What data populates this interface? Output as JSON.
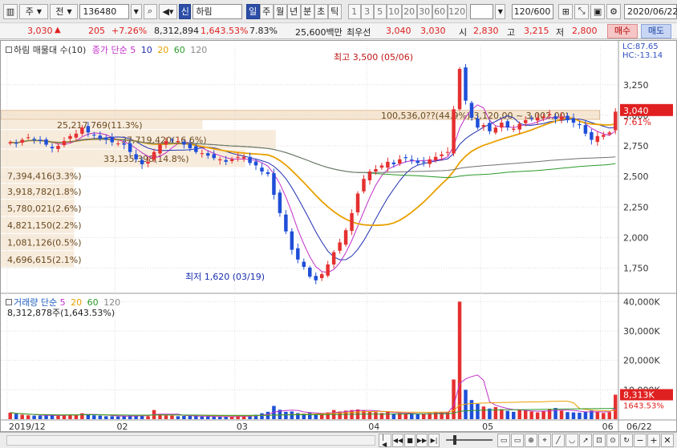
{
  "toolbar": {
    "market": "주",
    "mode": "전",
    "code": "136480",
    "badge": "신",
    "name": "하림",
    "periods": [
      "일",
      "주",
      "월",
      "년",
      "분",
      "초",
      "틱"
    ],
    "active_period": "일",
    "intervals": [
      "1",
      "3",
      "5",
      "10",
      "20",
      "30",
      "60",
      "120"
    ],
    "count": "120/600",
    "date": "2020/06/22"
  },
  "quote": {
    "price": "3,030",
    "change": "205",
    "pct": "+7.26%",
    "volume": "8,312,894",
    "vol_ratio": "1,643.53%",
    "turnover": "7.83%",
    "amount": "25,600백만",
    "pref_label": "최우선",
    "ask": "3,040",
    "bid": "3,030",
    "open_label": "시",
    "open": "2,830",
    "high_label": "고",
    "high": "3,215",
    "low_label": "저",
    "low": "2,800",
    "buy_label": "매수",
    "sell_label": "매도"
  },
  "chart_data": {
    "type": "candlestick",
    "title": "하림",
    "legend_price": {
      "label": "하림 매물대 수(10)",
      "ma_label": "종가 단순",
      "periods": [
        "5",
        "10",
        "20",
        "60",
        "120"
      ]
    },
    "legend_volume": {
      "label": "거래량 단순",
      "periods": [
        "5",
        "20",
        "60",
        "120"
      ]
    },
    "lc_hc": {
      "lc": "LC:87.65",
      "hc": "HC:-13.14"
    },
    "y_ticks": [
      "3,250",
      "3,000",
      "2,750",
      "2,500",
      "2,250",
      "2,000",
      "1,750"
    ],
    "y_tick_values": [
      3250,
      3000,
      2750,
      2500,
      2250,
      2000,
      1750
    ],
    "ylim": [
      1550,
      3570
    ],
    "vol_ticks": [
      "40,000K",
      "30,000K",
      "20,000K",
      "10,000K"
    ],
    "vol_tick_values": [
      40000,
      30000,
      20000,
      10000
    ],
    "vol_ylim": [
      0,
      42000
    ],
    "x_ticks": [
      "2019/12",
      "02",
      "03",
      "04",
      "05",
      "06",
      "06/22"
    ],
    "current_price_tag": "3,040",
    "current_pct_tag": "7.61%",
    "current_price": 3040,
    "current_vol_tag": "8,313K",
    "current_vol_pct_tag": "1643.53%",
    "current_vol": 8313,
    "high_annotation": "최고 3,500 (05/06)",
    "low_annotation": "최저 1,620 (03/19)",
    "volume_profile": [
      {
        "price_top": 3040,
        "price_bottom": 2960,
        "label": "100,536,0??(44.9%)(3,120,00 ~ 3,002,00)",
        "width": 0.98
      },
      {
        "price_top": 2960,
        "price_bottom": 2880,
        "label": "25,217,769(11.3%)",
        "width": 0.33
      },
      {
        "price_top": 2880,
        "price_bottom": 2720,
        "label": "37,719,420(16.6%)",
        "width": 0.45
      },
      {
        "price_top": 2720,
        "price_bottom": 2570,
        "label": "33,135,398(14.8%)",
        "width": 0.4
      },
      {
        "price_top": 2570,
        "price_bottom": 2440,
        "label": "7,394,416(3.3%)",
        "width": 0.12
      },
      {
        "price_top": 2440,
        "price_bottom": 2310,
        "label": "3,918,782(1.8%)",
        "width": 0.12
      },
      {
        "price_top": 2310,
        "price_bottom": 2170,
        "label": "5,780,021(2.6%)",
        "width": 0.12
      },
      {
        "price_top": 2170,
        "price_bottom": 2030,
        "label": "4,821,150(2.2%)",
        "width": 0.12
      },
      {
        "price_top": 2030,
        "price_bottom": 1890,
        "label": "1,081,126(0.5%)",
        "width": 0.12
      },
      {
        "price_top": 1890,
        "price_bottom": 1750,
        "label": "4,696,615(2.1%)",
        "width": 0.12
      }
    ],
    "volume_info": "8,312,878주(1,643.53%)",
    "colors": {
      "up": "#e53030",
      "down": "#1f4fd8",
      "ma5": "#c030c8",
      "ma10": "#1f2fb0",
      "ma20": "#e8a000",
      "ma60": "#2a9a2a",
      "ma120": "#707070"
    },
    "closes": [
      2780,
      2770,
      2800,
      2820,
      2800,
      2790,
      2760,
      2730,
      2750,
      2790,
      2830,
      2850,
      2900,
      2860,
      2840,
      2810,
      2800,
      2780,
      2770,
      2760,
      2700,
      2640,
      2600,
      2620,
      2700,
      2760,
      2790,
      2800,
      2790,
      2760,
      2730,
      2700,
      2690,
      2670,
      2650,
      2640,
      2620,
      2640,
      2660,
      2660,
      2610,
      2590,
      2540,
      2520,
      2350,
      2200,
      2050,
      1900,
      1820,
      1760,
      1680,
      1650,
      1700,
      1780,
      1880,
      1960,
      2060,
      2200,
      2360,
      2480,
      2540,
      2560,
      2590,
      2620,
      2600,
      2640,
      2650,
      2630,
      2610,
      2620,
      2640,
      2660,
      2680,
      2700,
      3050,
      3380,
      3120,
      2980,
      2900,
      2920,
      2870,
      2900,
      2940,
      2900,
      2890,
      2930,
      2960,
      2970,
      2980,
      2990,
      3010,
      2970,
      2990,
      2960,
      2940,
      2920,
      2850,
      2800,
      2830,
      2840,
      2860,
      3030
    ],
    "volumes": [
      2200,
      1800,
      1500,
      1300,
      1200,
      1200,
      1400,
      1300,
      1100,
      1500,
      1600,
      1400,
      2000,
      1700,
      1300,
      1200,
      1000,
      1000,
      900,
      1000,
      1200,
      1300,
      1400,
      1000,
      3100,
      1800,
      1300,
      1200,
      1000,
      1100,
      1100,
      1000,
      900,
      900,
      800,
      800,
      800,
      900,
      1100,
      1000,
      1200,
      1500,
      2000,
      2500,
      4500,
      3200,
      2500,
      2600,
      2100,
      1900,
      2200,
      1700,
      1900,
      2300,
      3100,
      2600,
      2900,
      3100,
      3300,
      2900,
      2600,
      2400,
      2100,
      2500,
      1900,
      2000,
      1900,
      1800,
      1700,
      1800,
      2100,
      2300,
      2400,
      2500,
      13500,
      40000,
      10000,
      6500,
      5200,
      4300,
      3600,
      4100,
      3400,
      2800,
      2500,
      3200,
      2900,
      2600,
      2300,
      2800,
      3500,
      3800,
      2900,
      2400,
      2300,
      2200,
      2600,
      2900,
      2500,
      2100,
      2400,
      8313
    ]
  },
  "bottom": {
    "zoom_minus": "−",
    "zoom_plus": "+",
    "close": "✕"
  }
}
